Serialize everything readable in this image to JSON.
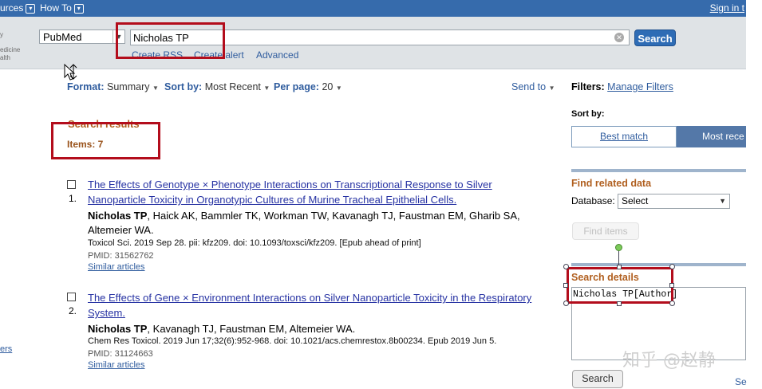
{
  "topnav": {
    "resources": "urces",
    "howto": "How To",
    "signin": "Sign in t"
  },
  "logo": {
    "line1": "y",
    "line2": "edicine",
    "line3": "alth"
  },
  "search": {
    "database": "PubMed",
    "term": "Nicholas TP",
    "button": "Search",
    "links": [
      "Create RSS",
      "Create alert",
      "Advanced"
    ]
  },
  "toolbar": {
    "format_label": "Format:",
    "format_value": "Summary",
    "sort_label": "Sort by:",
    "sort_value": "Most Recent",
    "perpage_label": "Per page:",
    "perpage_value": "20",
    "send_to": "Send to"
  },
  "filters": {
    "label": "Filters:",
    "manage": "Manage Filters"
  },
  "results": {
    "heading": "Search results",
    "items": "Items: 7",
    "list": [
      {
        "num": "1.",
        "title1": "The Effects of Genotype × Phenotype Interactions on Transcriptional Response to Silver",
        "title2": "Nanoparticle Toxicity in Organotypic Cultures of Murine Tracheal Epithelial Cells.",
        "author_bold": "Nicholas TP",
        "authors1": ", Haick AK, Bammler TK, Workman TW, Kavanagh TJ, Faustman EM, Gharib SA,",
        "authors2": "Altemeier WA.",
        "citation": "Toxicol Sci. 2019 Sep 28. pii: kfz209. doi: 10.1093/toxsci/kfz209. [Epub ahead of print]",
        "pmid": "PMID: 31562762",
        "similar": "Similar articles"
      },
      {
        "num": "2.",
        "title1": "The Effects of Gene × Environment Interactions on Silver Nanoparticle Toxicity in the Respiratory",
        "title2": "System.",
        "author_bold": "Nicholas TP",
        "authors1": ", Kavanagh TJ, Faustman EM, Altemeier WA.",
        "authors2": "",
        "citation": "Chem Res Toxicol. 2019 Jun 17;32(6):952-968. doi: 10.1021/acs.chemrestox.8b00234. Epub 2019 Jun 5.",
        "pmid": "PMID: 31124663",
        "similar": "Similar articles"
      }
    ]
  },
  "left_edge_link": "ers",
  "sidebar": {
    "sortby_label": "Sort by:",
    "best_match": "Best match",
    "most_recent": "Most rece",
    "find_related": "Find related data",
    "database_label": "Database:",
    "database_value": "Select",
    "find_items": "Find items",
    "search_details_title": "Search details",
    "search_details_text": "Nicholas TP[Author]",
    "search_button": "Search",
    "see_more": "Se"
  },
  "watermark": "知乎 @赵静"
}
